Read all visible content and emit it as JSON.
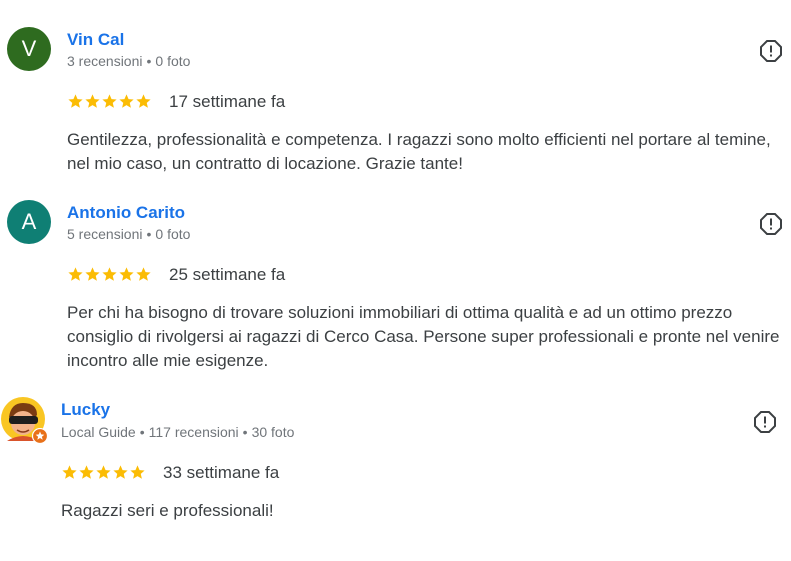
{
  "colors": {
    "link": "#1a73e8",
    "star": "#fbbc04",
    "meta": "#70757a",
    "body": "#3c4043"
  },
  "reviews": [
    {
      "avatar_letter": "V",
      "avatar_color": "#2e6b1f",
      "name": "Vin Cal",
      "badge": "",
      "reviews_count": "3 recensioni",
      "photos_count": "0 foto",
      "rating": 5,
      "when": "17 settimane fa",
      "text": "Gentilezza, professionalità e competenza. I ragazzi sono molto efficienti nel portare al temine, nel mio caso, un contratto di locazione. Grazie tante!"
    },
    {
      "avatar_letter": "A",
      "avatar_color": "#0f7f74",
      "name": "Antonio Carito",
      "badge": "",
      "reviews_count": "5 recensioni",
      "photos_count": "0 foto",
      "rating": 5,
      "when": "25 settimane fa",
      "text": "Per chi ha bisogno di trovare soluzioni immobiliari di ottima qualità e ad un ottimo prezzo consiglio di rivolgersi ai ragazzi di Cerco Casa. Persone super professionali e pronte nel venire incontro alle mie esigenze."
    },
    {
      "avatar_letter": "",
      "avatar_color": "#f9c623",
      "name": "Lucky",
      "badge": "Local Guide",
      "reviews_count": "117 recensioni",
      "photos_count": "30 foto",
      "rating": 5,
      "when": "33 settimane fa",
      "text": "Ragazzi seri e professionali!"
    }
  ],
  "icons": {
    "flag": "report-flag-icon",
    "star": "star-icon",
    "local_guide": "local-guide-badge-icon"
  }
}
